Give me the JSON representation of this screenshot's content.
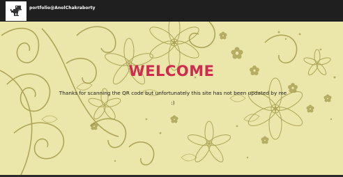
{
  "navbar": {
    "brand_text": "portfolio@AnolChakraborty",
    "logo_icon": "dino-icon"
  },
  "hero": {
    "title": "WELCOME",
    "message": "Thanks for scanning the QR code but unfortunately this site has not been updated by me :)"
  },
  "colors": {
    "navbar_bg": "#1f1f1f",
    "hero_bg": "#ebe6aa",
    "title": "#cf2b4e",
    "floral": "#a39a4a"
  }
}
